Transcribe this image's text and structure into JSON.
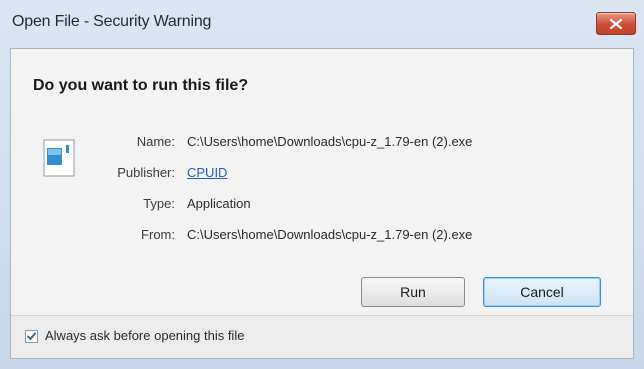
{
  "window": {
    "title": "Open File - Security Warning"
  },
  "dialog": {
    "heading": "Do you want to run this file?",
    "fields": {
      "name_label": "Name:",
      "name_value": "C:\\Users\\home\\Downloads\\cpu-z_1.79-en (2).exe",
      "publisher_label": "Publisher:",
      "publisher_value": "CPUID",
      "type_label": "Type:",
      "type_value": "Application",
      "from_label": "From:",
      "from_value": "C:\\Users\\home\\Downloads\\cpu-z_1.79-en (2).exe"
    },
    "buttons": {
      "run_label": "Run",
      "cancel_label": "Cancel"
    },
    "footer": {
      "checkbox_label": "Always ask before opening this file",
      "checkbox_checked": true
    }
  },
  "icons": {
    "close": "close-icon",
    "file": "application-file-icon",
    "check": "checkmark-icon"
  },
  "colors": {
    "close_button": "#cd4f36",
    "link": "#1f5fb3",
    "cancel_focus": "#3c8fd6"
  }
}
